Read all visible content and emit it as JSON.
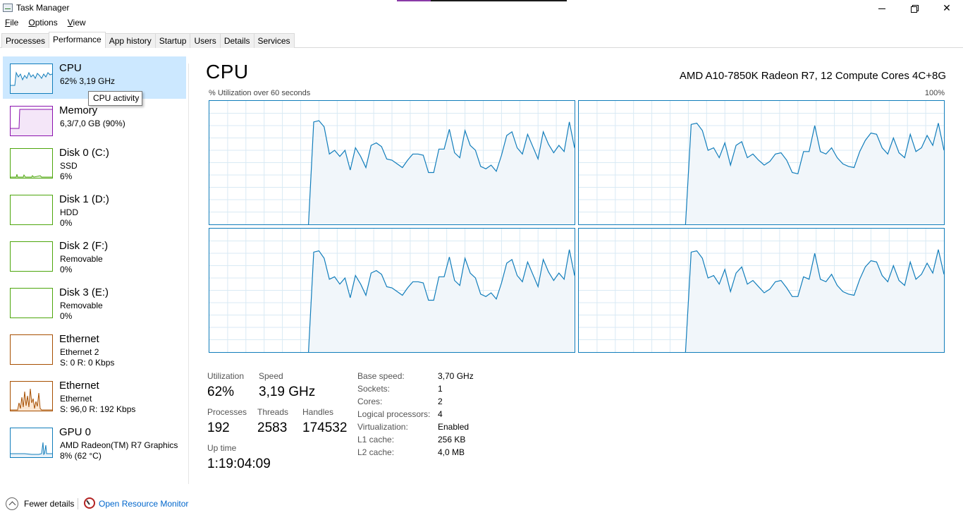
{
  "window": {
    "title": "Task Manager",
    "min_icon": "minimize-icon",
    "max_icon": "restore-icon",
    "close_icon": "close-icon",
    "close_glyph": "✕"
  },
  "menu": [
    {
      "label": "File",
      "underline": "F",
      "rest": "ile"
    },
    {
      "label": "Options",
      "underline": "O",
      "rest": "ptions"
    },
    {
      "label": "View",
      "underline": "V",
      "rest": "iew"
    }
  ],
  "tabs": [
    "Processes",
    "Performance",
    "App history",
    "Startup",
    "Users",
    "Details",
    "Services"
  ],
  "active_tab": "Performance",
  "sidebar": [
    {
      "id": "cpu",
      "title": "CPU",
      "lines": [
        "62% 3,19 GHz"
      ],
      "color": "#117dbb",
      "selected": true
    },
    {
      "id": "memory",
      "title": "Memory",
      "lines": [
        "6,3/7,0 GB (90%)"
      ],
      "color": "#8b12ae"
    },
    {
      "id": "disk0",
      "title": "Disk 0 (C:)",
      "lines": [
        "SSD",
        "6%"
      ],
      "color": "#4da60c"
    },
    {
      "id": "disk1",
      "title": "Disk 1 (D:)",
      "lines": [
        "HDD",
        "0%"
      ],
      "color": "#4da60c"
    },
    {
      "id": "disk2",
      "title": "Disk 2 (F:)",
      "lines": [
        "Removable",
        "0%"
      ],
      "color": "#4da60c"
    },
    {
      "id": "disk3",
      "title": "Disk 3 (E:)",
      "lines": [
        "Removable",
        "0%"
      ],
      "color": "#4da60c"
    },
    {
      "id": "ethernet1",
      "title": "Ethernet",
      "lines": [
        "Ethernet 2",
        "S: 0 R: 0 Kbps"
      ],
      "color": "#a74f01"
    },
    {
      "id": "ethernet2",
      "title": "Ethernet",
      "lines": [
        "Ethernet",
        "S: 96,0 R: 192 Kbps"
      ],
      "color": "#a74f01"
    },
    {
      "id": "gpu0",
      "title": "GPU 0",
      "lines": [
        "AMD Radeon(TM) R7 Graphics",
        "8% (62 °C)"
      ],
      "color": "#117dbb"
    }
  ],
  "tooltip": "CPU activity",
  "main": {
    "title": "CPU",
    "model": "AMD A10-7850K Radeon R7, 12 Compute Cores 4C+8G",
    "graph_caption_left": "% Utilization over 60 seconds",
    "graph_caption_right": "100%",
    "graph_color": "#117dbb",
    "graph_fill": "#f1f6fa",
    "grid_color": "#d9eaf4"
  },
  "stats": {
    "utilization_label": "Utilization",
    "utilization_value": "62%",
    "speed_label": "Speed",
    "speed_value": "3,19 GHz",
    "processes_label": "Processes",
    "processes_value": "192",
    "threads_label": "Threads",
    "threads_value": "2583",
    "handles_label": "Handles",
    "handles_value": "174532",
    "uptime_label": "Up time",
    "uptime_value": "1:19:04:09"
  },
  "details": [
    {
      "label": "Base speed:",
      "value": "3,70 GHz"
    },
    {
      "label": "Sockets:",
      "value": "1"
    },
    {
      "label": "Cores:",
      "value": "2"
    },
    {
      "label": "Logical processors:",
      "value": "4"
    },
    {
      "label": "Virtualization:",
      "value": "Enabled"
    },
    {
      "label": "L1 cache:",
      "value": "256 KB"
    },
    {
      "label": "L2 cache:",
      "value": "4,0 MB"
    }
  ],
  "footer": {
    "fewer_details": "Fewer details",
    "open_resource_monitor": "Open Resource Monitor"
  },
  "chart_data": {
    "type": "line",
    "series": [
      {
        "name": "",
        "values": [
          0,
          0,
          0,
          0,
          0,
          0,
          0,
          0,
          0,
          0,
          0,
          0,
          0,
          0,
          0,
          0,
          0,
          0,
          0,
          0,
          83,
          84,
          79,
          57,
          60,
          55,
          60,
          44,
          62,
          55,
          46,
          64,
          66,
          63,
          53,
          52,
          49,
          46,
          52,
          57,
          57,
          56,
          42,
          42,
          61,
          61,
          77,
          58,
          54,
          76,
          64,
          60,
          47,
          45,
          48,
          43,
          56,
          72,
          75,
          62,
          57,
          73,
          63,
          53,
          75,
          65,
          58,
          64,
          59,
          83,
          62
        ]
      },
      {
        "name": "",
        "values": [
          0,
          0,
          0,
          0,
          0,
          0,
          0,
          0,
          0,
          0,
          0,
          0,
          0,
          0,
          0,
          0,
          0,
          0,
          0,
          0,
          81,
          82,
          76,
          60,
          62,
          54,
          66,
          48,
          64,
          67,
          54,
          57,
          52,
          48,
          51,
          57,
          58,
          52,
          42,
          41,
          59,
          59,
          80,
          59,
          57,
          62,
          54,
          49,
          47,
          46,
          59,
          68,
          74,
          73,
          62,
          57,
          70,
          58,
          54,
          73,
          59,
          62,
          72,
          64,
          82,
          60
        ]
      },
      {
        "name": "",
        "values": [
          0,
          0,
          0,
          0,
          0,
          0,
          0,
          0,
          0,
          0,
          0,
          0,
          0,
          0,
          0,
          0,
          0,
          0,
          0,
          0,
          81,
          82,
          76,
          59,
          61,
          55,
          60,
          44,
          62,
          55,
          46,
          64,
          66,
          63,
          53,
          52,
          49,
          46,
          52,
          57,
          57,
          56,
          42,
          42,
          61,
          61,
          77,
          58,
          54,
          76,
          64,
          60,
          47,
          45,
          48,
          43,
          56,
          72,
          75,
          62,
          57,
          73,
          63,
          53,
          75,
          65,
          58,
          64,
          59,
          83,
          62
        ]
      },
      {
        "name": "",
        "values": [
          0,
          0,
          0,
          0,
          0,
          0,
          0,
          0,
          0,
          0,
          0,
          0,
          0,
          0,
          0,
          0,
          0,
          0,
          0,
          0,
          81,
          82,
          76,
          60,
          62,
          55,
          67,
          49,
          64,
          69,
          55,
          58,
          53,
          48,
          51,
          57,
          58,
          52,
          45,
          45,
          61,
          59,
          80,
          59,
          57,
          63,
          54,
          49,
          47,
          46,
          59,
          69,
          74,
          73,
          62,
          57,
          70,
          58,
          54,
          73,
          59,
          63,
          72,
          64,
          83,
          63
        ]
      }
    ],
    "ylim": [
      0,
      100
    ]
  }
}
